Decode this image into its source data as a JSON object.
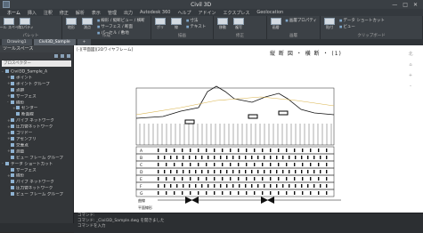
{
  "app": {
    "title": "Civil 3D",
    "win_controls": [
      "—",
      "□",
      "✕"
    ]
  },
  "ribbon_tabs": [
    "ホーム",
    "挿入",
    "注釈",
    "修正",
    "解析",
    "表示",
    "管理",
    "出力",
    "Autodesk 360",
    "ヘルプ",
    "アドイン",
    "エクスプレス",
    "Geolocation"
  ],
  "ribbon_groups": [
    {
      "label": "パレット",
      "big": [
        "ツール スペース",
        "プロパティ"
      ],
      "small": []
    },
    {
      "label": "作成",
      "big": [
        "地形",
        "測点"
      ],
      "small": [
        "線形 / 縦断ビュー / 横断",
        "サーフェス / 断面",
        "パーセル / 敷地"
      ]
    },
    {
      "label": "描画",
      "big": [
        "ポリ",
        "線"
      ],
      "small": [
        "寸法",
        "テキスト"
      ]
    },
    {
      "label": "修正",
      "big": [
        "移動",
        "複写"
      ],
      "small": []
    },
    {
      "label": "画層",
      "big": [
        "画層"
      ],
      "small": [
        "画層プロパティ"
      ]
    },
    {
      "label": "クリップボード",
      "big": [
        "貼付"
      ],
      "small": [
        "データ ショートカット",
        "ビュー"
      ]
    }
  ],
  "doc_tabs": [
    "Drawing1",
    "Civil3D_Sample",
    "+"
  ],
  "panel": {
    "title": "ツールスペース",
    "search": "プロスペクター",
    "tree": [
      {
        "label": "Civil3D_Sample_A",
        "depth": 0,
        "toggle": "-"
      },
      {
        "label": "ポイント",
        "depth": 1,
        "toggle": "+"
      },
      {
        "label": "ポイント グループ",
        "depth": 1,
        "toggle": "+"
      },
      {
        "label": "点群",
        "depth": 1,
        "toggle": ""
      },
      {
        "label": "サーフェス",
        "depth": 1,
        "toggle": "+"
      },
      {
        "label": "線形",
        "depth": 1,
        "toggle": "-"
      },
      {
        "label": "センター",
        "depth": 2,
        "toggle": "+"
      },
      {
        "label": "断面線",
        "depth": 2,
        "toggle": ""
      },
      {
        "label": "パイプ ネットワーク",
        "depth": 1,
        "toggle": "+"
      },
      {
        "label": "圧力管ネットワーク",
        "depth": 1,
        "toggle": "+"
      },
      {
        "label": "コリドー",
        "depth": 1,
        "toggle": "+"
      },
      {
        "label": "アセンブリ",
        "depth": 1,
        "toggle": "+"
      },
      {
        "label": "交差点",
        "depth": 1,
        "toggle": ""
      },
      {
        "label": "測量",
        "depth": 1,
        "toggle": "+"
      },
      {
        "label": "ビュー フレーム グループ",
        "depth": 1,
        "toggle": ""
      },
      {
        "label": "データ ショートカット",
        "depth": 0,
        "toggle": "-"
      },
      {
        "label": "サーフェス",
        "depth": 1,
        "toggle": ""
      },
      {
        "label": "線形",
        "depth": 1,
        "toggle": "+"
      },
      {
        "label": "パイプ ネットワーク",
        "depth": 1,
        "toggle": ""
      },
      {
        "label": "圧力管ネットワーク",
        "depth": 1,
        "toggle": ""
      },
      {
        "label": "ビュー フレーム グループ",
        "depth": 1,
        "toggle": ""
      }
    ]
  },
  "drawing": {
    "view_caption": "[-][平面図][2Dワイヤフレーム]",
    "title": "縦 断 図 ・ 横 断 ・ (1)",
    "viewcube": [
      "北",
      "⌂",
      "+",
      "–"
    ],
    "row_labels": [
      "A",
      "B",
      "C",
      "D",
      "E",
      "F",
      "G"
    ],
    "bottom_labels": [
      "曲線",
      "平面線形"
    ]
  },
  "command": {
    "lines": [
      "コマンド:",
      "コマンド: _Civil3D_Sample.dwg を開きました",
      "コマンドを入力"
    ]
  }
}
